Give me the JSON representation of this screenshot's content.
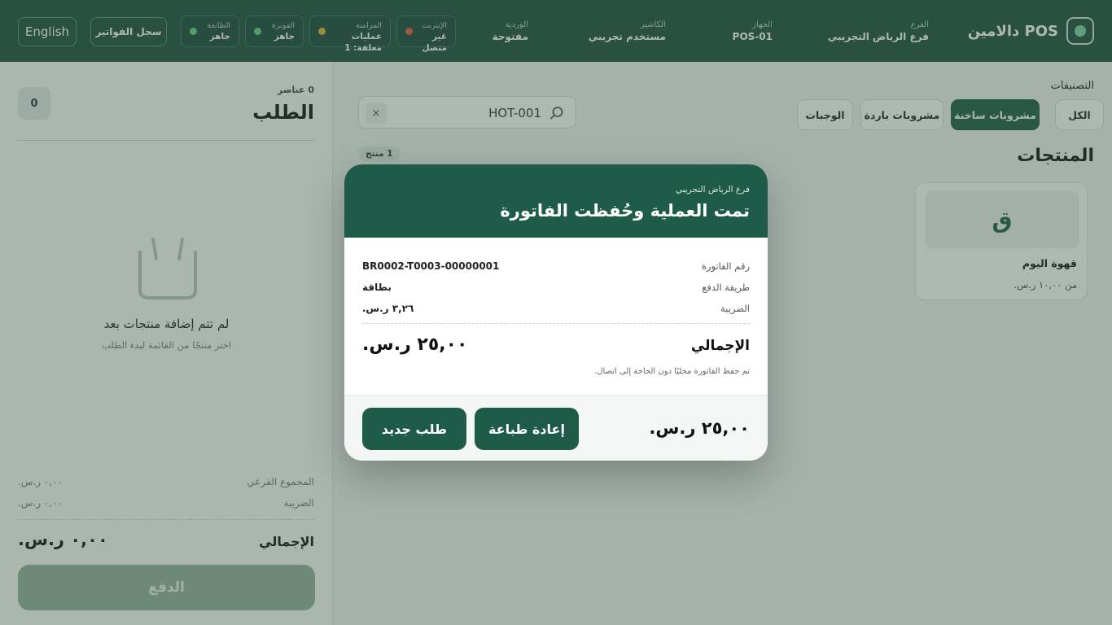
{
  "header": {
    "brand": "دالامين POS",
    "branch": {
      "label": "الفرع",
      "value": "فرع الرياض التجريبي"
    },
    "device": {
      "label": "الجهاز",
      "value": "POS-01"
    },
    "cashier": {
      "label": "الكاشير",
      "value": "مستخدم تجريبي"
    },
    "shift": {
      "label": "الوردية",
      "value": "مفتوحة"
    },
    "status": [
      {
        "label": "الإنترنت",
        "value": "غير متصل",
        "color": "#e35b52"
      },
      {
        "label": "المزامنة",
        "value": "عمليات معلقة: 1",
        "color": "#e0b232"
      },
      {
        "label": "الفوترة",
        "value": "جاهز",
        "color": "#5fcf83"
      },
      {
        "label": "الطابعة",
        "value": "جاهز",
        "color": "#5fcf83"
      }
    ],
    "invoices_button": "سجل الفواتير",
    "language_button": "English"
  },
  "order": {
    "items_meta": "0 عناصر",
    "title": "الطلب",
    "count": "0",
    "empty_title": "لم تتم إضافة منتجات بعد",
    "empty_subtitle": "اختر منتجًا من القائمة لبدء الطلب",
    "subtotal_label": "المجموع الفرعي",
    "subtotal_value": "٠,٠٠ ر.س.",
    "tax_label": "الضريبة",
    "tax_value": "٠,٠٠ ر.س.",
    "total_label": "الإجمالي",
    "total_value": "٠,٠٠ ر.س.",
    "pay_button": "الدفع"
  },
  "catalog": {
    "categories_label": "التصنيفات",
    "categories": [
      "الكل",
      "مشروبات ساخنة",
      "مشروبات باردة",
      "الوجبات"
    ],
    "active_category": "مشروبات ساخنة",
    "search_value": "HOT-001",
    "search_clear": "×",
    "products_title": "المنتجات",
    "products_count": "1 منتج",
    "products": [
      {
        "initial": "ق",
        "name": "قهوة اليوم",
        "price": "من ١٠,٠٠ ر.س."
      }
    ]
  },
  "modal": {
    "branch": "فرع الرياض التجريبي",
    "title": "تمت العملية وحُفظت الفاتورة",
    "invoice_label": "رقم الفاتورة",
    "invoice_value": "BR0002-T0003-00000001",
    "payment_label": "طريقة الدفع",
    "payment_value": "بطاقة",
    "tax_label": "الضريبة",
    "tax_value": "٣,٢٦ ر.س.",
    "total_label": "الإجمالي",
    "total_value": "٢٥,٠٠ ر.س.",
    "note": "تم حفظ الفاتورة محليًا دون الحاجة إلى اتصال.",
    "footer_total": "٢٥,٠٠ ر.س.",
    "reprint_button": "إعادة طباعة",
    "new_order_button": "طلب جديد"
  }
}
